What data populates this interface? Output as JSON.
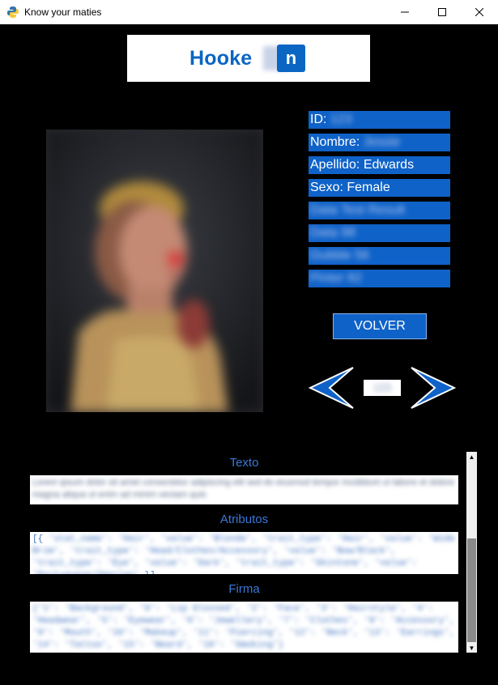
{
  "window": {
    "title": "Know your maties",
    "minimize_icon": "minimize-icon",
    "maximize_icon": "maximize-icon",
    "close_icon": "close-icon"
  },
  "logo": {
    "text": "Hooke",
    "badge": "n",
    "hidden_letters": "dI"
  },
  "profile": {
    "fields": [
      {
        "label": "ID:",
        "value": "123"
      },
      {
        "label": "Nombre:",
        "value": "Jessie"
      },
      {
        "label": "Apellido:",
        "value": "Edwards"
      },
      {
        "label": "Sexo:",
        "value": "Female"
      },
      {
        "label": "",
        "value": "Data Test Result"
      },
      {
        "label": "",
        "value": "Data 98"
      },
      {
        "label": "",
        "value": "Dubble 56"
      },
      {
        "label": "",
        "value": "Pinter 82"
      }
    ],
    "photo_icon": "profile-photo"
  },
  "nav": {
    "back_button": "VOLVER",
    "prev_icon": "arrow-left-icon",
    "next_icon": "arrow-right-icon",
    "page_value": "123"
  },
  "sections": {
    "texto_label": "Texto",
    "texto_content": "Lorem ipsum dolor sit amet consectetur adipiscing elit sed do eiusmod tempor incididunt ut labore et dolore magna aliqua ut enim ad minim veniam quis",
    "atributos_label": "Atributos",
    "atributos_open": "[{",
    "atributos_content": "'stat_name': 'Hair', 'value': 'Blonde', 'trait_type': 'Hair', 'value': 'Wide Brim', 'trait_type': 'Head/Clothes/Accessory', 'value': 'Bow/Black', 'trait_type': 'Eye', 'value': 'Dark', 'trait_type': 'Skintone', 'value': 'Portuguese/Iberian'",
    "atributos_close": "}]",
    "firma_label": "Firma",
    "firma_content": "{'1': 'Background', '0': 'Lip Glossed', '2': 'Face', '3': 'Hairstyle', '4': 'Headwear', '5': 'Eyewear', '6': 'Jewellery', '7': 'Clothes', '8': 'Accessory', '9': 'Mouth', '10': 'Makeup', '11': 'Piercing', '12': 'Neck', '13': 'Earrings', '14': 'Tattoo', '15': 'Beard', '16': 'Smoking'}"
  },
  "colors": {
    "accent": "#0f62c8",
    "background": "#000000",
    "label": "#3a78d8"
  }
}
